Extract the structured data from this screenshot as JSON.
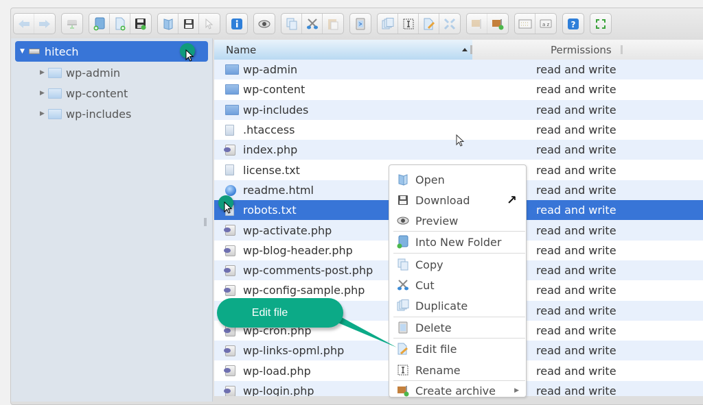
{
  "toolbar": {
    "groups": [
      [
        {
          "icon": "back-arrow-icon",
          "label": "Back",
          "disabled": true
        },
        {
          "icon": "forward-arrow-icon",
          "label": "Forward",
          "disabled": true
        }
      ],
      [
        {
          "icon": "reload-drive-icon",
          "label": "Reload",
          "disabled": true
        }
      ],
      [
        {
          "icon": "new-folder-icon",
          "label": "New folder"
        },
        {
          "icon": "new-file-icon",
          "label": "New file"
        },
        {
          "icon": "upload-icon",
          "label": "Upload"
        }
      ],
      [
        {
          "icon": "open-icon",
          "label": "Open"
        },
        {
          "icon": "download-icon",
          "label": "Download"
        },
        {
          "icon": "select-icon",
          "label": "Select",
          "disabled": true
        }
      ],
      [
        {
          "icon": "info-icon",
          "label": "Get info"
        }
      ],
      [
        {
          "icon": "preview-eye-icon",
          "label": "Preview"
        }
      ],
      [
        {
          "icon": "copy-icon",
          "label": "Copy"
        },
        {
          "icon": "cut-icon",
          "label": "Cut"
        },
        {
          "icon": "paste-icon",
          "label": "Paste",
          "disabled": true
        }
      ],
      [
        {
          "icon": "delete-icon",
          "label": "Delete"
        }
      ],
      [
        {
          "icon": "duplicate-icon",
          "label": "Duplicate"
        },
        {
          "icon": "rename-icon",
          "label": "Rename"
        },
        {
          "icon": "edit-file-icon",
          "label": "Edit file"
        },
        {
          "icon": "resize-icon",
          "label": "Resize",
          "disabled": true
        }
      ],
      [
        {
          "icon": "extract-icon",
          "label": "Extract",
          "disabled": true
        },
        {
          "icon": "create-archive-icon",
          "label": "Create archive"
        }
      ],
      [
        {
          "icon": "icons-view-icon",
          "label": "View"
        },
        {
          "icon": "sort-icon",
          "label": "Sort"
        }
      ],
      [
        {
          "icon": "help-icon",
          "label": "Help"
        }
      ],
      [
        {
          "icon": "fullscreen-icon",
          "label": "Full screen"
        }
      ]
    ]
  },
  "sidebar": {
    "root": {
      "label": "hitech"
    },
    "items": [
      {
        "label": "wp-admin"
      },
      {
        "label": "wp-content"
      },
      {
        "label": "wp-includes"
      }
    ]
  },
  "list": {
    "columns": {
      "name": "Name",
      "permissions": "Permissions"
    },
    "rows": [
      {
        "name": "wp-admin",
        "type": "folder",
        "permissions": "read and write"
      },
      {
        "name": "wp-content",
        "type": "folder",
        "permissions": "read and write"
      },
      {
        "name": "wp-includes",
        "type": "folder",
        "permissions": "read and write"
      },
      {
        "name": ".htaccess",
        "type": "text",
        "permissions": "read and write"
      },
      {
        "name": "index.php",
        "type": "php",
        "permissions": "read and write"
      },
      {
        "name": "license.txt",
        "type": "text",
        "permissions": "read and write"
      },
      {
        "name": "readme.html",
        "type": "html",
        "permissions": "read and write"
      },
      {
        "name": "robots.txt",
        "type": "text",
        "permissions": "read and write",
        "selected": true
      },
      {
        "name": "wp-activate.php",
        "type": "php",
        "permissions": "read and write"
      },
      {
        "name": "wp-blog-header.php",
        "type": "php",
        "permissions": "read and write"
      },
      {
        "name": "wp-comments-post.php",
        "type": "php",
        "permissions": "read and write"
      },
      {
        "name": "wp-config-sample.php",
        "type": "php",
        "permissions": "read and write"
      },
      {
        "name": "",
        "type": "php",
        "permissions": "read and write"
      },
      {
        "name": "wp-cron.php",
        "type": "php",
        "permissions": "read and write"
      },
      {
        "name": "wp-links-opml.php",
        "type": "php",
        "permissions": "read and write"
      },
      {
        "name": "wp-load.php",
        "type": "php",
        "permissions": "read and write"
      },
      {
        "name": "wp-login.php",
        "type": "php",
        "permissions": "read and write"
      }
    ]
  },
  "context_menu": {
    "items": [
      {
        "label": "Open",
        "icon": "open-icon"
      },
      {
        "label": "Download",
        "icon": "download-icon",
        "external": "↗"
      },
      {
        "label": "Preview",
        "icon": "preview-eye-icon"
      },
      {
        "label": "Into New Folder",
        "icon": "new-folder-icon"
      },
      {
        "label": "Copy",
        "icon": "copy-icon"
      },
      {
        "label": "Cut",
        "icon": "cut-icon"
      },
      {
        "label": "Duplicate",
        "icon": "duplicate-icon"
      },
      {
        "label": "Delete",
        "icon": "delete-icon"
      },
      {
        "label": "Edit file",
        "icon": "edit-file-icon"
      },
      {
        "label": "Rename",
        "icon": "rename-icon"
      },
      {
        "label": "Create archive",
        "icon": "create-archive-icon",
        "submenu": "▶"
      }
    ]
  },
  "callout": {
    "text": "Edit file",
    "color": "#0caa87"
  },
  "colors": {
    "selection": "#3875d7",
    "row_alt": "#e8f0fc",
    "sidebar_bg": "#dde4ec"
  }
}
